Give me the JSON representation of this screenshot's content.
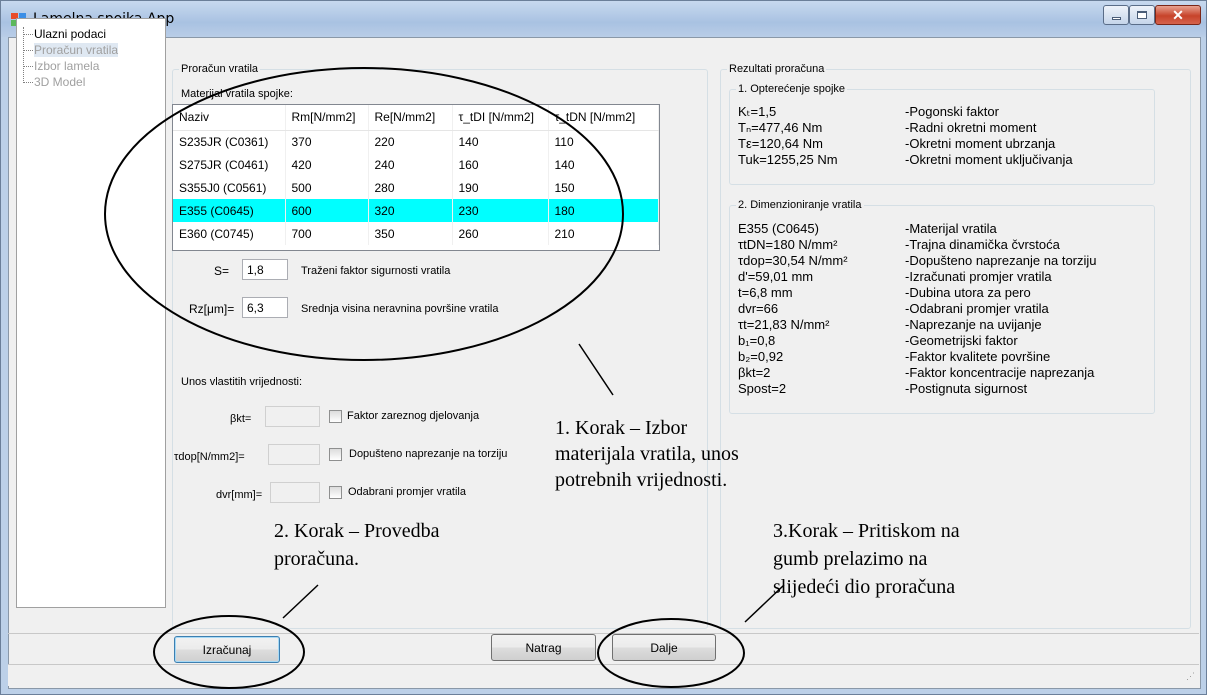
{
  "window": {
    "title": "Lamelna spojka App"
  },
  "tree": {
    "items": [
      {
        "label": "Ulazni podaci",
        "enabled": true
      },
      {
        "label": "Proračun vratila",
        "enabled": false
      },
      {
        "label": "Izbor lamela",
        "enabled": false
      },
      {
        "label": "3D Model",
        "enabled": false
      }
    ]
  },
  "calc": {
    "group_title": "Proračun vratila",
    "material_label": "Materijal vratila spojke:",
    "table": {
      "headers": [
        "Naziv",
        "Rm[N/mm2]",
        "Re[N/mm2]",
        "τ_tDI [N/mm2]",
        "τ_tDN [N/mm2]"
      ],
      "rows": [
        [
          "S235JR (C0361)",
          "370",
          "220",
          "140",
          "110"
        ],
        [
          "S275JR (C0461)",
          "420",
          "240",
          "160",
          "140"
        ],
        [
          "S355J0 (C0561)",
          "500",
          "280",
          "190",
          "150"
        ],
        [
          "E355 (C0645)",
          "600",
          "320",
          "230",
          "180"
        ],
        [
          "E360 (C0745)",
          "700",
          "350",
          "260",
          "210"
        ]
      ],
      "selected_row": 3
    },
    "s_label": "S=",
    "s_value": "1,8",
    "s_desc": "Traženi faktor sigurnosti vratila",
    "rz_label": "Rz[μm]=",
    "rz_value": "6,3",
    "rz_desc": "Srednja visina neravnina  površine vratila",
    "custom_title": "Unos vlastitih vrijednosti:",
    "custom": [
      {
        "label": "βkt=",
        "check_label": "Faktor zareznog djelovanja"
      },
      {
        "label": "τdop[N/mm2]=",
        "check_label": "Dopušteno naprezanje na torziju"
      },
      {
        "label": "dvr[mm]=",
        "check_label": "Odabrani promjer vratila"
      }
    ]
  },
  "results": {
    "group_title": "Rezultati proračuna",
    "section1_title": "1. Opterećenje spojke",
    "section1": [
      [
        "Kₜ=1,5",
        "-Pogonski faktor"
      ],
      [
        "Tₙ=477,46 Nm",
        "-Radni okretni moment"
      ],
      [
        "Tε=120,64 Nm",
        "-Okretni moment ubrzanja"
      ],
      [
        "Tuk=1255,25 Nm",
        "-Okretni moment uključivanja"
      ]
    ],
    "section2_title": "2. Dimenzioniranje vratila",
    "section2": [
      [
        "E355 (C0645)",
        "-Materijal vratila"
      ],
      [
        "τtDN=180 N/mm²",
        "-Trajna dinamička čvrstoća"
      ],
      [
        "τdop=30,54 N/mm²",
        "-Dopušteno naprezanje na torziju"
      ],
      [
        "d'=59,01 mm",
        "-Izračunati promjer vratila"
      ],
      [
        "t=6,8 mm",
        "-Dubina utora za pero"
      ],
      [
        "dvr=66",
        "-Odabrani promjer vratila"
      ],
      [
        "τt=21,83 N/mm²",
        "-Naprezanje na uvijanje"
      ],
      [
        "b₁=0,8",
        "-Geometrijski faktor"
      ],
      [
        "b₂=0,92",
        "-Faktor kvalitete površine"
      ],
      [
        "βkt=2",
        "-Faktor koncentracije naprezanja"
      ],
      [
        "Spost=2",
        "-Postignuta sigurnost"
      ]
    ]
  },
  "buttons": {
    "calculate": "Izračunaj",
    "back": "Natrag",
    "next": "Dalje"
  },
  "annotations": {
    "step1": [
      "1. Korak – Izbor",
      "materijala vratila, unos",
      "potrebnih vrijednosti."
    ],
    "step2": [
      "2. Korak – Provedba",
      "proračuna."
    ],
    "step3": [
      "3.Korak – Pritiskom na",
      "gumb prelazimo na",
      "slijedeći dio proračuna"
    ]
  }
}
